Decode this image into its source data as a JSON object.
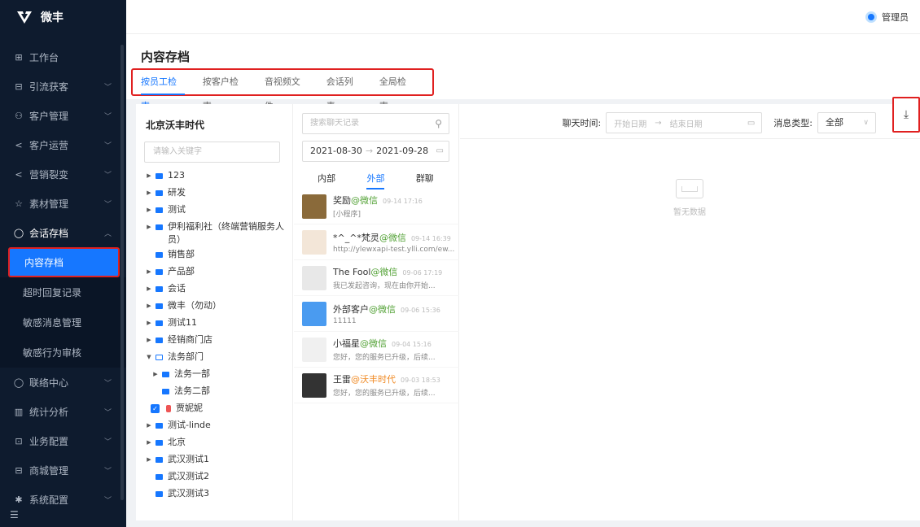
{
  "app": {
    "name": "微丰"
  },
  "sidebar": {
    "items": [
      {
        "label": "工作台",
        "icon": "grid-icon",
        "chev": false
      },
      {
        "label": "引流获客",
        "icon": "funnel-icon",
        "chev": true
      },
      {
        "label": "客户管理",
        "icon": "users-icon",
        "chev": true
      },
      {
        "label": "客户运营",
        "icon": "share-icon",
        "chev": true
      },
      {
        "label": "营销裂变",
        "icon": "fission-icon",
        "chev": true
      },
      {
        "label": "素材管理",
        "icon": "star-icon",
        "chev": true
      },
      {
        "label": "会话存档",
        "icon": "chat-icon",
        "chev": true,
        "open": true
      }
    ],
    "sub_items": [
      "内容存档",
      "超时回复记录",
      "敏感消息管理",
      "敏感行为审核"
    ],
    "items_after": [
      {
        "label": "联络中心",
        "icon": "phone-icon"
      },
      {
        "label": "统计分析",
        "icon": "chart-icon"
      },
      {
        "label": "业务配置",
        "icon": "config-icon"
      },
      {
        "label": "商城管理",
        "icon": "shop-icon"
      },
      {
        "label": "系统配置",
        "icon": "settings-icon"
      }
    ],
    "collapse_icon": "menu-collapse-icon"
  },
  "topbar": {
    "user": "管理员"
  },
  "page": {
    "title": "内容存档",
    "tabs": [
      "按员工检索",
      "按客户检索",
      "音视频文件",
      "会话列表",
      "全局检索"
    ],
    "active_tab": 0
  },
  "org": {
    "name": "北京沃丰时代",
    "keyword_placeholder": "请输入关键字",
    "tree": [
      {
        "label": "123",
        "arrow": true
      },
      {
        "label": "研发",
        "arrow": true
      },
      {
        "label": "测试",
        "arrow": true
      },
      {
        "label": "伊利福利社（终端营销服务人员）",
        "arrow": true
      },
      {
        "label": "销售部",
        "arrow": false
      },
      {
        "label": "产品部",
        "arrow": true
      },
      {
        "label": "会话",
        "arrow": true
      },
      {
        "label": "微丰（勿动）",
        "arrow": true
      },
      {
        "label": "测试11",
        "arrow": true
      },
      {
        "label": "经销商门店",
        "arrow": true
      },
      {
        "label": "法务部门",
        "arrow": true,
        "open": true
      },
      {
        "label": "法务一部",
        "arrow": true,
        "indent": 1
      },
      {
        "label": "法务二部",
        "arrow": false,
        "indent": 1
      },
      {
        "label": "贾妮妮",
        "person": true,
        "indent": 1
      },
      {
        "label": "测试-linde",
        "arrow": true
      },
      {
        "label": "北京",
        "arrow": true
      },
      {
        "label": "武汉测试1",
        "arrow": true
      },
      {
        "label": "武汉测试2",
        "arrow": false
      },
      {
        "label": "武汉测试3",
        "arrow": false
      }
    ]
  },
  "chat": {
    "search_placeholder": "搜索聊天记录",
    "date_start": "2021-08-30",
    "date_end": "2021-09-28",
    "tabs": [
      "内部",
      "外部",
      "群聊"
    ],
    "active_tab": 1,
    "items": [
      {
        "name": "奖励",
        "tag": "@微信",
        "time": "09-14 17:16",
        "preview": "[小程序]",
        "avatar_color": "#8a6a3a"
      },
      {
        "name": "*^_^*梵灵",
        "tag": "@微信",
        "time": "09-14 16:39",
        "preview": "http://ylewxapi-test.ylli.com/ew...",
        "avatar_color": "#f3e6d8"
      },
      {
        "name": "The Fool",
        "tag": "@微信",
        "time": "09-06 17:19",
        "preview": "我已发起咨询，现在由你开始...",
        "avatar_color": "#e8e8e8"
      },
      {
        "name": "外部客户",
        "tag": "@微信",
        "time": "09-06 15:36",
        "preview": "11111",
        "avatar_color": "#4a9bf0"
      },
      {
        "name": "小福星",
        "tag": "@微信",
        "time": "09-04 15:16",
        "preview": "您好，您的服务已升级，后续...",
        "avatar_color": "#f0f0f0"
      },
      {
        "name": "王雷",
        "tag": "@沃丰时代",
        "time": "09-03 18:53",
        "preview": "您好，您的服务已升级，后续...",
        "avatar_color": "#333333",
        "org": true
      }
    ]
  },
  "detail": {
    "time_label": "聊天时间:",
    "start_placeholder": "开始日期",
    "end_placeholder": "结束日期",
    "type_label": "消息类型:",
    "type_value": "全部",
    "empty_text": "暂无数据"
  }
}
